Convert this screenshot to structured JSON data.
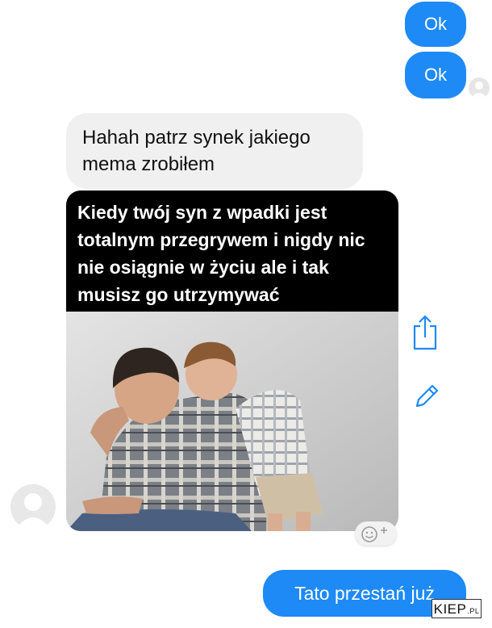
{
  "messages": {
    "outgoing_1": "Ok",
    "outgoing_2": "Ok",
    "incoming_text": "Hahah patrz synek jakiego mema zrobiłem",
    "meme_caption": "Kiedy twój syn z wpadki jest totalnym przegrywem i nigdy nic nie osiągnie w życiu ale i tak musisz go utrzymywać",
    "outgoing_3": "Tato przestań już"
  },
  "icons": {
    "share": "share-icon",
    "edit": "pencil-icon",
    "react": "emoji-react-icon",
    "avatar": "default-avatar-icon"
  },
  "watermark": {
    "main": "KIEP",
    "suffix": ".PL"
  },
  "colors": {
    "outgoing_bubble": "#1e8af5",
    "incoming_bubble": "#f0f0f0",
    "icon_blue": "#1e8af5"
  }
}
